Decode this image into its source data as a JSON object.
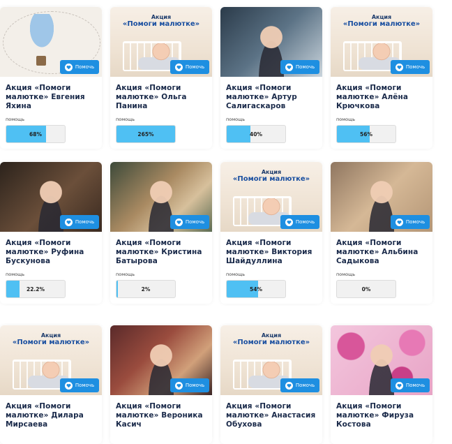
{
  "help_button_label": "Помочь",
  "help_label": "помощь",
  "promo": {
    "line1": "Акция",
    "line2": "«Помоги малютке»"
  },
  "cards": [
    {
      "name": "Акция «Помоги малютке» Евгения Яхина",
      "percent": "68%",
      "fill": 0.68,
      "image": "photo-balloon-logo"
    },
    {
      "name": "Акция «Помоги малютке» Ольга Панина",
      "percent": "265%",
      "fill": 1.0,
      "image": "promo"
    },
    {
      "name": "Акция «Помоги малютке» Артур Салигаскаров",
      "percent": "40%",
      "fill": 0.4,
      "image": "photo-man"
    },
    {
      "name": "Акция «Помоги малютке» Алёна Крючкова",
      "percent": "56%",
      "fill": 0.56,
      "image": "promo"
    },
    {
      "name": "Акция «Помоги малютке» Руфина Бускунова",
      "percent": "22.2%",
      "fill": 0.222,
      "image": "photo-dark"
    },
    {
      "name": "Акция «Помоги малютке» Кристина Батырова",
      "percent": "2%",
      "fill": 0.02,
      "image": "photo-blonde"
    },
    {
      "name": "Акция «Помоги малютке» Виктория Шайдуллина",
      "percent": "54%",
      "fill": 0.54,
      "image": "promo"
    },
    {
      "name": "Акция «Помоги малютке» Альбина Садыкова",
      "percent": "0%",
      "fill": 0.0,
      "image": "photo-room"
    },
    {
      "name": "Акция «Помоги малютке» Дилара Мирсаева",
      "percent": "",
      "fill": 0,
      "image": "promo"
    },
    {
      "name": "Акция «Помоги малютке» Вероника Касич",
      "percent": "",
      "fill": 0,
      "image": "photo-selfie"
    },
    {
      "name": "Акция «Помоги малютке» Анастасия Обухова",
      "percent": "",
      "fill": 0,
      "image": "promo"
    },
    {
      "name": "Акция «Помоги малютке» Фируза Костова",
      "percent": "",
      "fill": 0,
      "image": "photo-balloons"
    }
  ],
  "colors": {
    "button": "#1e8fe1",
    "progress_fill": "#4fc0f3",
    "title": "#1a2a4a"
  },
  "icons": {
    "help_button": "heart-icon"
  }
}
